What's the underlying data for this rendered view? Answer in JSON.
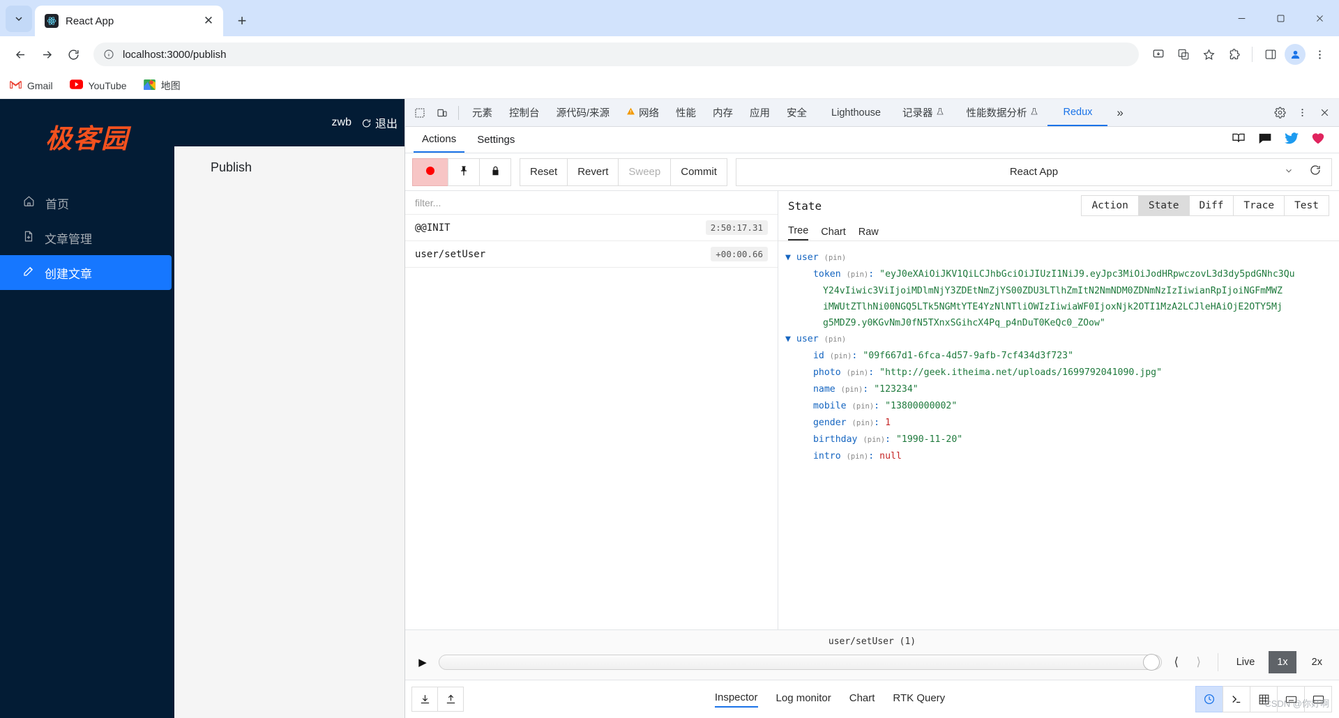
{
  "browser": {
    "tab": {
      "title": "React App",
      "favicon": "react-icon"
    },
    "url": "localhost:3000/publish",
    "nav": {
      "back": "back-arrow",
      "forward": "forward-arrow",
      "reload": "reload-icon"
    },
    "bookmarks": [
      {
        "label": "Gmail",
        "icon": "gmail-icon"
      },
      {
        "label": "YouTube",
        "icon": "youtube-icon"
      },
      {
        "label": "地图",
        "icon": "maps-icon"
      }
    ],
    "window_controls": {
      "minimize": "–",
      "maximize": "❐",
      "close": "✕"
    },
    "new_tab_label": "+",
    "close_tab_label": "✕"
  },
  "app": {
    "logo": "极客园",
    "username": "zwb",
    "logout_label": "退出",
    "menu": [
      {
        "label": "首页",
        "icon": "home-icon",
        "active": false
      },
      {
        "label": "文章管理",
        "icon": "document-icon",
        "active": false
      },
      {
        "label": "创建文章",
        "icon": "edit-icon",
        "active": true
      }
    ],
    "page_title": "Publish"
  },
  "devtools": {
    "tabs": [
      {
        "label": "元素",
        "selected": false
      },
      {
        "label": "控制台",
        "selected": false
      },
      {
        "label": "源代码/来源",
        "selected": false
      },
      {
        "label": "网络",
        "selected": false,
        "warn": true
      },
      {
        "label": "性能",
        "selected": false
      },
      {
        "label": "内存",
        "selected": false
      },
      {
        "label": "应用",
        "selected": false
      },
      {
        "label": "安全",
        "selected": false
      },
      {
        "label": "Lighthouse",
        "selected": false
      },
      {
        "label": "记录器",
        "selected": false,
        "beaker": true
      },
      {
        "label": "性能数据分析",
        "selected": false,
        "beaker": true
      },
      {
        "label": "Redux",
        "selected": true
      }
    ],
    "overflow_label": "»",
    "settings_icon": "gear-icon",
    "more_icon": "kebab-menu-icon",
    "close_icon": "close-icon",
    "inspect_icon": "inspect-element-icon",
    "device_icon": "device-toolbar-icon"
  },
  "redux": {
    "subtabs": [
      {
        "label": "Actions",
        "selected": true
      },
      {
        "label": "Settings",
        "selected": false
      }
    ],
    "sub_right_icons": [
      "book-icon",
      "chat-icon",
      "twitter-icon",
      "heart-icon"
    ],
    "toolbar": {
      "record_icon": "record-icon",
      "pin_icon": "pin-icon",
      "lock_icon": "lock-icon",
      "reset_label": "Reset",
      "revert_label": "Revert",
      "sweep_label": "Sweep",
      "commit_label": "Commit",
      "instance_label": "React App",
      "chevron_icon": "chevron-down-icon",
      "refresh_icon": "refresh-icon"
    },
    "filter_placeholder": "filter...",
    "actions": [
      {
        "name": "@@INIT",
        "time": "2:50:17.31"
      },
      {
        "name": "user/setUser",
        "time": "+00:00.66"
      }
    ],
    "state_panel": {
      "title": "State",
      "tabs": [
        {
          "label": "Action",
          "selected": false
        },
        {
          "label": "State",
          "selected": true
        },
        {
          "label": "Diff",
          "selected": false
        },
        {
          "label": "Trace",
          "selected": false
        },
        {
          "label": "Test",
          "selected": false
        }
      ],
      "view_tabs": [
        {
          "label": "Tree",
          "selected": true
        },
        {
          "label": "Chart",
          "selected": false
        },
        {
          "label": "Raw",
          "selected": false
        }
      ],
      "pin_label": "(pin)",
      "tree": {
        "root1_key": "user",
        "token_key": "token",
        "token_lines": [
          "\"eyJ0eXAiOiJKV1QiLCJhbGciOiJIUzI1NiJ9.eyJpc3MiOiJodHRpwczovL3d3dy5pdGNhc3Qu",
          "Y24vIiwic3ViIjoiMDlmNjY3ZDEtNmZjYS00ZDU3LTlhZmItN2NmNDM0ZDNmNzIzIiwianRpIjoiNGFmMWZ",
          "iMWUtZTlhNi00NGQ5LTk5NGMtYTE4YzNlNTliOWIzIiwiaWF0IjoxNjk2OTI1MzA2LCJleHAiOjE2OTY5Mj",
          "g5MDZ9.y0KGvNmJ0fN5TXnxSGihcX4Pq_p4nDuT0KeQc0_ZOow\""
        ],
        "root2_key": "user",
        "fields": [
          {
            "key": "id",
            "value": "\"09f667d1-6fca-4d57-9afb-7cf434d3f723\"",
            "type": "string"
          },
          {
            "key": "photo",
            "value": "\"http://geek.itheima.net/uploads/1699792041090.jpg\"",
            "type": "string"
          },
          {
            "key": "name",
            "value": "\"123234\"",
            "type": "string"
          },
          {
            "key": "mobile",
            "value": "\"13800000002\"",
            "type": "string"
          },
          {
            "key": "gender",
            "value": "1",
            "type": "number"
          },
          {
            "key": "birthday",
            "value": "\"1990-11-20\"",
            "type": "string"
          },
          {
            "key": "intro",
            "value": "null",
            "type": "null"
          }
        ]
      }
    },
    "slider": {
      "label": "user/setUser (1)",
      "play_icon": "play-icon",
      "prev_icon": "prev-icon",
      "next_icon": "next-icon",
      "live_label": "Live",
      "speed_1x": "1x",
      "speed_2x": "2x"
    },
    "bottom": {
      "import_icon": "import-icon",
      "export_icon": "export-icon",
      "tabs": [
        {
          "label": "Inspector",
          "selected": true
        },
        {
          "label": "Log monitor",
          "selected": false
        },
        {
          "label": "Chart",
          "selected": false
        },
        {
          "label": "RTK Query",
          "selected": false
        }
      ],
      "right_icons": [
        "history-icon",
        "terminal-icon",
        "grid-icon",
        "keyboard-icon",
        "dock-icon"
      ]
    }
  },
  "watermark": "CSDN @你好啊"
}
